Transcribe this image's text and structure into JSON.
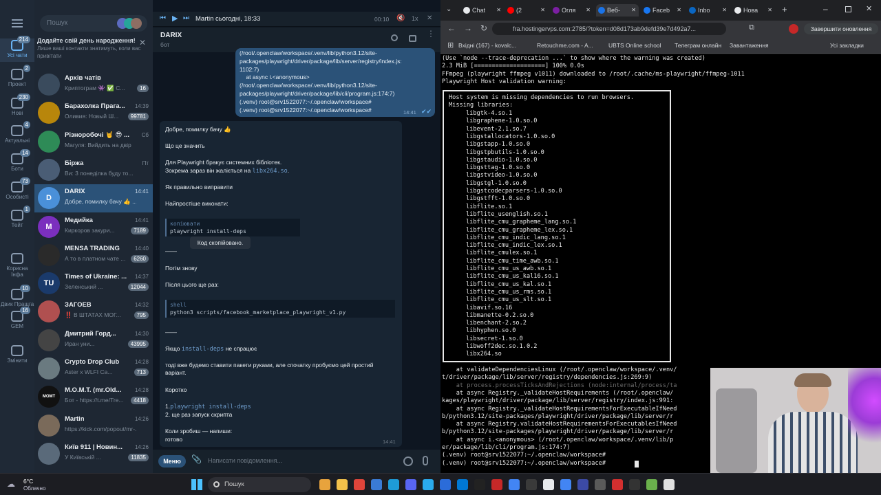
{
  "telegram": {
    "search_placeholder": "Пошук",
    "birthday_title": "Додайте свій день народження!",
    "birthday_sub": "Лише ваші контакти знатимуть, коли вас привітати",
    "rail": [
      {
        "label": "Усі чати",
        "badge": "214"
      },
      {
        "label": "Проект",
        "badge": "2"
      },
      {
        "label": "Нові",
        "badge": "230"
      },
      {
        "label": "Актуальні",
        "badge": "4"
      },
      {
        "label": "Боти",
        "badge": "14"
      },
      {
        "label": "Особисті",
        "badge": "73"
      },
      {
        "label": "Тейт",
        "badge": "1"
      },
      {
        "label": "Корисна Інфа",
        "badge": ""
      },
      {
        "label": "Двик Пращга",
        "badge": "10"
      },
      {
        "label": "GEM",
        "badge": "16"
      },
      {
        "label": "Змінити",
        "badge": ""
      }
    ],
    "chats": [
      {
        "name": "Архів чатів",
        "preview": "Криптограм 👾 ✅ C...",
        "time": "",
        "badge": "16",
        "avatar": "",
        "color": "#3a4b5d"
      },
      {
        "name": "Барахолка Прага...",
        "preview": "Оливия: Новый Ш...",
        "time": "14:39",
        "badge": "99781",
        "avatar": "",
        "color": "#b8860b"
      },
      {
        "name": "Різноробочі 🤘 😎 ...",
        "preview": "Магуля: Вийдить на двір",
        "time": "Сб",
        "badge": "",
        "avatar": "",
        "color": "#2e8b57"
      },
      {
        "name": "Біржа",
        "preview": "Ви: 3 понеділка буду то...",
        "time": "Пт",
        "badge": "",
        "avatar": "",
        "color": "#4a5d75"
      },
      {
        "name": "DARIX",
        "preview": "Добре, помилку бачу 👍 ...",
        "time": "14:41",
        "badge": "",
        "avatar": "D",
        "color": "#4a90d9"
      },
      {
        "name": "Медийка",
        "preview": "Киркоров закури...",
        "time": "14:41",
        "badge": "7189",
        "avatar": "M",
        "color": "#7b2fbe"
      },
      {
        "name": "MENSA TRADING",
        "preview": "А то в платном чате ...",
        "time": "14:40",
        "badge": "6260",
        "avatar": "",
        "color": "#2a2a2a"
      },
      {
        "name": "Times of Ukraine: ...",
        "preview": "Зеленський ...",
        "time": "14:37",
        "badge": "12044",
        "avatar": "TU",
        "color": "#1a3a6b"
      },
      {
        "name": "ЗАГОЕВ",
        "preview": "‼️ В ШТАТАХ МОГ...",
        "time": "14:32",
        "badge": "795",
        "avatar": "",
        "color": "#b05050"
      },
      {
        "name": "Дмитрий Горд...",
        "preview": "Иран уни...",
        "time": "14:30",
        "badge": "43995",
        "avatar": "",
        "color": "#444"
      },
      {
        "name": "Crypto Drop Club",
        "preview": "Aster x WLFI Ca...",
        "time": "14:28",
        "badge": "713",
        "avatar": "",
        "color": "#6a7a80"
      },
      {
        "name": "M.O.M.T. (mr.Old...",
        "preview": "Бот - https://t.me/Tre...",
        "time": "14:28",
        "badge": "4418",
        "avatar": "MOMT",
        "color": "#111"
      },
      {
        "name": "Martin",
        "preview": "https://kick.com/popout/mr-...",
        "time": "14:26",
        "badge": "",
        "avatar": "",
        "color": "#7a6a5a"
      },
      {
        "name": "Київ 911 | Новин...",
        "preview": "У Київській ...",
        "time": "14:26",
        "badge": "11835",
        "avatar": "",
        "color": "#5a6a7a"
      }
    ],
    "player": {
      "title": "Martin сьогодні, 18:33",
      "time": "00:10"
    },
    "header": {
      "name": "DARIX",
      "status": "бот"
    },
    "out_message": [
      "(/root/.openclaw/workspace/.venv/lib/python3.12/site-",
      "packages/playwright/driver/package/lib/server/registry/index.js:",
      "1102:7)",
      "    at async i.<anonymous>",
      "(/root/.openclaw/workspace/.venv/lib/python3.12/site-",
      "packages/playwright/driver/package/lib/cli/program.js:174:7)",
      "(.venv) root@srv1522077:~/.openclaw/workspace#",
      "(.venv) root@srv1522077:~/.openclaw/workspace#"
    ],
    "out_time": "14:41",
    "reply": {
      "greeting": "Добре, помилку бачу 👍",
      "q1": "Що це значить",
      "p1a": "Для Playwright бракує системних бібліотек.",
      "p1b": "Зокрема зараз він жаліється на",
      "lib": "libx264.so",
      "q2": "Як правильно виправити",
      "q3": "Найпростіше виконати:",
      "code1_lang": "копіювати",
      "code1": "playwright install-deps",
      "tooltip": "Код скопійовано.",
      "dash1": "——",
      "then": "Потім знову",
      "after": "Після цього ще раз:",
      "code2_lang": "shell",
      "code2": "python3 scripts/facebook_marketplace_playwright_v1.py",
      "dash2": "——",
      "if_pre": "Якщо",
      "if_code": "install-deps",
      "if_post": "не спрацює",
      "then2a": "тоді вже будемо ставити пакети руками, але спочатку пробуємо цей простий",
      "then2b": "варіант.",
      "short": "Коротко",
      "s1_num": "1.",
      "s1": "playwright install-deps",
      "s2": "2. ще раз запуск скрипта",
      "done1": "Коли зробиш — напиши:",
      "done2": "готово",
      "time": "14:41"
    },
    "composer": {
      "menu": "Меню",
      "placeholder": "Написати повідомлення..."
    }
  },
  "browser": {
    "tabs": [
      "Chat",
      "(2",
      "Огля",
      "Веб-",
      "Faceb",
      "Inbo",
      "Нова"
    ],
    "url": "fra.hostingervps.com:2785/?token=d08d173ab9defd39e7d492a7...",
    "update_label": "Завершити оновлення",
    "bookmarks": [
      "Вхідні (167) - kovalc...",
      "Retouchme.com - A...",
      "UBTS Online school",
      "Телеграм онлайн",
      "Завантаження",
      "Усі закладки"
    ]
  },
  "terminal": {
    "top_lines": [
      "(Use `node --trace-deprecation ...` to show where the warning was created)",
      "2.3 MiB [====================] 100% 0.0s",
      "FFmpeg (playwright ffmpeg v1011) downloaded to /root/.cache/ms-playwright/ffmpeg-1011",
      "Playwright Host validation warning:"
    ],
    "box_head": [
      "Host system is missing dependencies to run browsers.",
      "Missing libraries:"
    ],
    "libs": [
      "libgtk-4.so.1",
      "libgraphene-1.0.so.0",
      "libevent-2.1.so.7",
      "libgstallocators-1.0.so.0",
      "libgstapp-1.0.so.0",
      "libgstpbutils-1.0.so.0",
      "libgstaudio-1.0.so.0",
      "libgsttag-1.0.so.0",
      "libgstvideo-1.0.so.0",
      "libgstgl-1.0.so.0",
      "libgstcodecparsers-1.0.so.0",
      "libgstfft-1.0.so.0",
      "libflite.so.1",
      "libflite_usenglish.so.1",
      "libflite_cmu_grapheme_lang.so.1",
      "libflite_cmu_grapheme_lex.so.1",
      "libflite_cmu_indic_lang.so.1",
      "libflite_cmu_indic_lex.so.1",
      "libflite_cmulex.so.1",
      "libflite_cmu_time_awb.so.1",
      "libflite_cmu_us_awb.so.1",
      "libflite_cmu_us_kal16.so.1",
      "libflite_cmu_us_kal.so.1",
      "libflite_cmu_us_rms.so.1",
      "libflite_cmu_us_slt.so.1",
      "libavif.so.16",
      "libmanette-0.2.so.0",
      "libenchant-2.so.2",
      "libhyphen.so.0",
      "libsecret-1.so.0",
      "libwoff2dec.so.1.0.2",
      "libx264.so"
    ],
    "stack": [
      "    at validateDependenciesLinux (/root/.openclaw/workspace/.venv/",
      "t/driver/package/lib/server/registry/dependencies.js:269:9)",
      "    at process.processTicksAndRejections (node:internal/process/ta",
      "    at async Registry._validateHostRequirements (/root/.openclaw/",
      "kages/playwright/driver/package/lib/server/registry/index.js:991:",
      "    at async Registry._validateHostRequirementsForExecutableIfNeed",
      "b/python3.12/site-packages/playwright/driver/package/lib/server/r",
      "    at async Registry.validateHostRequirementsForExecutablesIfNeed",
      "b/python3.12/site-packages/playwright/driver/package/lib/server/r",
      "    at async i.<anonymous> (/root/.openclaw/workspace/.venv/lib/p",
      "er/package/lib/cli/program.js:174:7)",
      "(.venv) root@srv1522077:~/.openclaw/workspace#",
      "(.venv) root@srv1522077:~/.openclaw/workspace# "
    ]
  },
  "taskbar": {
    "weather_temp": "6°C",
    "weather_desc": "Облачно",
    "search": "Пошук"
  },
  "colors": {
    "accent": "#2b5278",
    "tg_bg": "#0e1621",
    "term_bg": "#000000"
  }
}
